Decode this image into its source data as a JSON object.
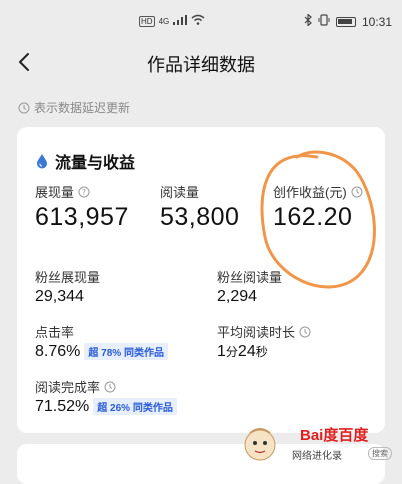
{
  "statusbar": {
    "signal_text": "HD",
    "signal_sub": "4G",
    "time": "10:31"
  },
  "nav": {
    "title": "作品详细数据"
  },
  "notice": {
    "text": "表示数据延迟更新"
  },
  "section": {
    "title": "流量与收益"
  },
  "metrics": {
    "impressions": {
      "label": "展现量",
      "value": "613,957"
    },
    "reads": {
      "label": "阅读量",
      "value": "53,800"
    },
    "earnings": {
      "label": "创作收益(元)",
      "value": "162.20"
    },
    "fan_impressions": {
      "label": "粉丝展现量",
      "value": "29,344"
    },
    "fan_reads": {
      "label": "粉丝阅读量",
      "value": "2,294"
    },
    "ctr": {
      "label": "点击率",
      "value": "8.76%",
      "badge_prefix": "超",
      "badge_pct": "78%",
      "badge_suffix": "同类作品"
    },
    "avg_time": {
      "label": "平均阅读时长",
      "minutes": "1",
      "min_unit": "分",
      "seconds": "24",
      "sec_unit": "秒"
    },
    "completion": {
      "label": "阅读完成率",
      "value": "71.52%",
      "badge_prefix": "超",
      "badge_pct": "26%",
      "badge_suffix": "同类作品"
    }
  },
  "watermark": {
    "logo": "Bai度百度",
    "text": "网络进化录",
    "search": "搜索"
  },
  "colors": {
    "accent": "#2a5bd7",
    "annotation": "#f0964a",
    "drop_icon": "#3a78d8"
  }
}
